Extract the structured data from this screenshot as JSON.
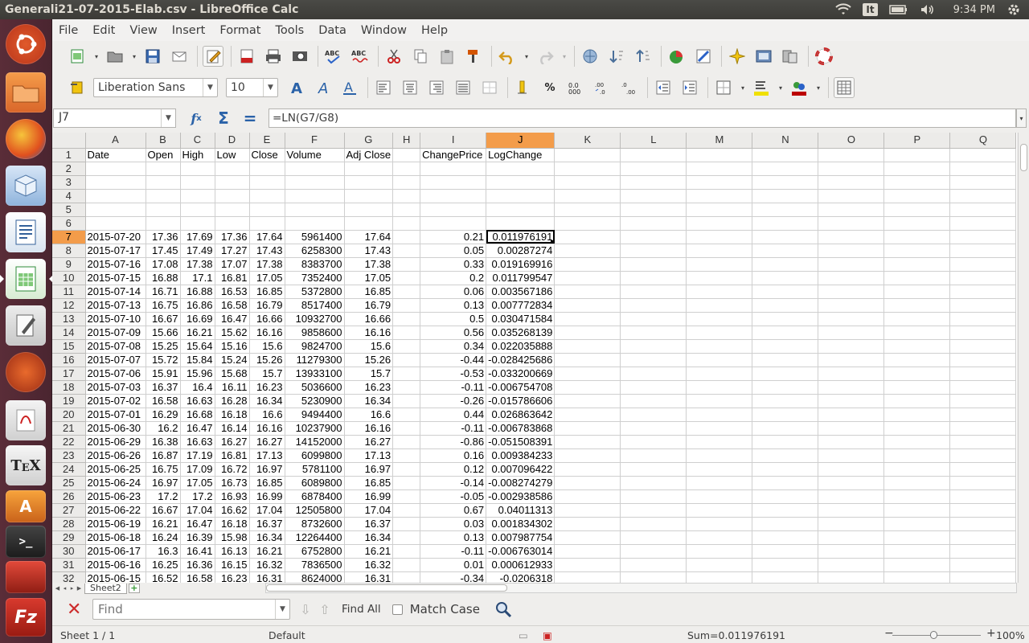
{
  "window": {
    "title": "Generali21-07-2015-Elab.csv - LibreOffice Calc"
  },
  "panel": {
    "keyboard": "It",
    "time": "9:34 PM"
  },
  "launcher": [
    "Ubuntu Dash",
    "Files",
    "Firefox",
    "Software",
    "Writer",
    "Calc",
    "Text Editor",
    "Ubuntu One",
    "Document Viewer",
    "TeX",
    "Font Manager",
    "Terminal",
    "Update Manager",
    "FileZilla"
  ],
  "menu": [
    "File",
    "Edit",
    "View",
    "Insert",
    "Format",
    "Tools",
    "Data",
    "Window",
    "Help"
  ],
  "format_toolbar": {
    "font_name": "Liberation Sans",
    "font_size": "10"
  },
  "formula_bar": {
    "cell_ref": "J7",
    "formula": "=LN(G7/G8)"
  },
  "grid": {
    "columns": [
      "A",
      "B",
      "C",
      "D",
      "E",
      "F",
      "G",
      "H",
      "I",
      "J",
      "K",
      "L",
      "M",
      "N",
      "O",
      "P",
      "Q"
    ],
    "selected_column": "J",
    "selected_row": "7",
    "header_row": [
      "Date",
      "Open",
      "High",
      "Low",
      "Close",
      "Volume",
      "Adj Close",
      "",
      "ChangePrice",
      "LogChange",
      "",
      "",
      "",
      "",
      "",
      "",
      ""
    ],
    "rows": [
      {
        "n": "1",
        "cells": [
          "Date",
          "Open",
          "High",
          "Low",
          "Close",
          "Volume",
          "Adj Close",
          "",
          "ChangePrice",
          "LogChange"
        ]
      },
      {
        "n": "2",
        "cells": [
          "",
          "",
          "",
          "",
          "",
          "",
          "",
          "",
          "",
          ""
        ]
      },
      {
        "n": "3",
        "cells": [
          "",
          "",
          "",
          "",
          "",
          "",
          "",
          "",
          "",
          ""
        ]
      },
      {
        "n": "4",
        "cells": [
          "",
          "",
          "",
          "",
          "",
          "",
          "",
          "",
          "",
          ""
        ]
      },
      {
        "n": "5",
        "cells": [
          "",
          "",
          "",
          "",
          "",
          "",
          "",
          "",
          "",
          ""
        ]
      },
      {
        "n": "6",
        "cells": [
          "",
          "",
          "",
          "",
          "",
          "",
          "",
          "",
          "",
          ""
        ]
      },
      {
        "n": "7",
        "cells": [
          "2015-07-20",
          "17.36",
          "17.69",
          "17.36",
          "17.64",
          "5961400",
          "17.64",
          "",
          "0.21",
          "0.011976191"
        ]
      },
      {
        "n": "8",
        "cells": [
          "2015-07-17",
          "17.45",
          "17.49",
          "17.27",
          "17.43",
          "6258300",
          "17.43",
          "",
          "0.05",
          "0.00287274"
        ]
      },
      {
        "n": "9",
        "cells": [
          "2015-07-16",
          "17.08",
          "17.38",
          "17.07",
          "17.38",
          "8383700",
          "17.38",
          "",
          "0.33",
          "0.019169916"
        ]
      },
      {
        "n": "10",
        "cells": [
          "2015-07-15",
          "16.88",
          "17.1",
          "16.81",
          "17.05",
          "7352400",
          "17.05",
          "",
          "0.2",
          "0.011799547"
        ]
      },
      {
        "n": "11",
        "cells": [
          "2015-07-14",
          "16.71",
          "16.88",
          "16.53",
          "16.85",
          "5372800",
          "16.85",
          "",
          "0.06",
          "0.003567186"
        ]
      },
      {
        "n": "12",
        "cells": [
          "2015-07-13",
          "16.75",
          "16.86",
          "16.58",
          "16.79",
          "8517400",
          "16.79",
          "",
          "0.13",
          "0.007772834"
        ]
      },
      {
        "n": "13",
        "cells": [
          "2015-07-10",
          "16.67",
          "16.69",
          "16.47",
          "16.66",
          "10932700",
          "16.66",
          "",
          "0.5",
          "0.030471584"
        ]
      },
      {
        "n": "14",
        "cells": [
          "2015-07-09",
          "15.66",
          "16.21",
          "15.62",
          "16.16",
          "9858600",
          "16.16",
          "",
          "0.56",
          "0.035268139"
        ]
      },
      {
        "n": "15",
        "cells": [
          "2015-07-08",
          "15.25",
          "15.64",
          "15.16",
          "15.6",
          "9824700",
          "15.6",
          "",
          "0.34",
          "0.022035888"
        ]
      },
      {
        "n": "16",
        "cells": [
          "2015-07-07",
          "15.72",
          "15.84",
          "15.24",
          "15.26",
          "11279300",
          "15.26",
          "",
          "-0.44",
          "-0.028425686"
        ]
      },
      {
        "n": "17",
        "cells": [
          "2015-07-06",
          "15.91",
          "15.96",
          "15.68",
          "15.7",
          "13933100",
          "15.7",
          "",
          "-0.53",
          "-0.033200669"
        ]
      },
      {
        "n": "18",
        "cells": [
          "2015-07-03",
          "16.37",
          "16.4",
          "16.11",
          "16.23",
          "5036600",
          "16.23",
          "",
          "-0.11",
          "-0.006754708"
        ]
      },
      {
        "n": "19",
        "cells": [
          "2015-07-02",
          "16.58",
          "16.63",
          "16.28",
          "16.34",
          "5230900",
          "16.34",
          "",
          "-0.26",
          "-0.015786606"
        ]
      },
      {
        "n": "20",
        "cells": [
          "2015-07-01",
          "16.29",
          "16.68",
          "16.18",
          "16.6",
          "9494400",
          "16.6",
          "",
          "0.44",
          "0.026863642"
        ]
      },
      {
        "n": "21",
        "cells": [
          "2015-06-30",
          "16.2",
          "16.47",
          "16.14",
          "16.16",
          "10237900",
          "16.16",
          "",
          "-0.11",
          "-0.006783868"
        ]
      },
      {
        "n": "22",
        "cells": [
          "2015-06-29",
          "16.38",
          "16.63",
          "16.27",
          "16.27",
          "14152000",
          "16.27",
          "",
          "-0.86",
          "-0.051508391"
        ]
      },
      {
        "n": "23",
        "cells": [
          "2015-06-26",
          "16.87",
          "17.19",
          "16.81",
          "17.13",
          "6099800",
          "17.13",
          "",
          "0.16",
          "0.009384233"
        ]
      },
      {
        "n": "24",
        "cells": [
          "2015-06-25",
          "16.75",
          "17.09",
          "16.72",
          "16.97",
          "5781100",
          "16.97",
          "",
          "0.12",
          "0.007096422"
        ]
      },
      {
        "n": "25",
        "cells": [
          "2015-06-24",
          "16.97",
          "17.05",
          "16.73",
          "16.85",
          "6089800",
          "16.85",
          "",
          "-0.14",
          "-0.008274279"
        ]
      },
      {
        "n": "26",
        "cells": [
          "2015-06-23",
          "17.2",
          "17.2",
          "16.93",
          "16.99",
          "6878400",
          "16.99",
          "",
          "-0.05",
          "-0.002938586"
        ]
      },
      {
        "n": "27",
        "cells": [
          "2015-06-22",
          "16.67",
          "17.04",
          "16.62",
          "17.04",
          "12505800",
          "17.04",
          "",
          "0.67",
          "0.04011313"
        ]
      },
      {
        "n": "28",
        "cells": [
          "2015-06-19",
          "16.21",
          "16.47",
          "16.18",
          "16.37",
          "8732600",
          "16.37",
          "",
          "0.03",
          "0.001834302"
        ]
      },
      {
        "n": "29",
        "cells": [
          "2015-06-18",
          "16.24",
          "16.39",
          "15.98",
          "16.34",
          "12264400",
          "16.34",
          "",
          "0.13",
          "0.007987754"
        ]
      },
      {
        "n": "30",
        "cells": [
          "2015-06-17",
          "16.3",
          "16.41",
          "16.13",
          "16.21",
          "6752800",
          "16.21",
          "",
          "-0.11",
          "-0.006763014"
        ]
      },
      {
        "n": "31",
        "cells": [
          "2015-06-16",
          "16.25",
          "16.36",
          "16.15",
          "16.32",
          "7836500",
          "16.32",
          "",
          "0.01",
          "0.000612933"
        ]
      },
      {
        "n": "32",
        "cells": [
          "2015-06-15",
          "16.52",
          "16.58",
          "16.23",
          "16.31",
          "8624000",
          "16.31",
          "",
          "-0.34",
          "-0.0206318"
        ]
      }
    ]
  },
  "sheet_tabs": [
    "Sheet2"
  ],
  "findbar": {
    "placeholder": "Find",
    "find_all": "Find All",
    "match_case": "Match Case"
  },
  "status": {
    "sheet": "Sheet 1 / 1",
    "style": "Default",
    "sum": "Sum=0.011976191",
    "zoom": "100%"
  }
}
